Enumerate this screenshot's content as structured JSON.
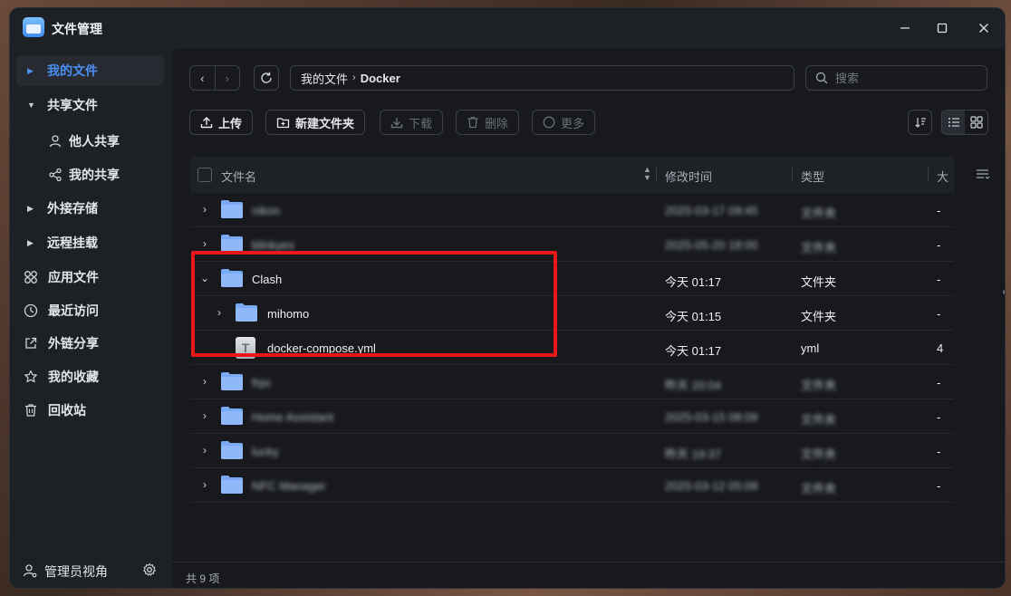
{
  "window": {
    "title": "文件管理"
  },
  "sidebar": {
    "items": [
      {
        "label": "我的文件"
      },
      {
        "label": "共享文件"
      },
      {
        "label": "他人共享"
      },
      {
        "label": "我的共享"
      },
      {
        "label": "外接存储"
      },
      {
        "label": "远程挂载"
      },
      {
        "label": "应用文件"
      },
      {
        "label": "最近访问"
      },
      {
        "label": "外链分享"
      },
      {
        "label": "我的收藏"
      },
      {
        "label": "回收站"
      }
    ],
    "footer_label": "管理员视角"
  },
  "breadcrumb": {
    "root": "我的文件",
    "current": "Docker"
  },
  "search": {
    "placeholder": "搜索"
  },
  "toolbar": {
    "upload": "上传",
    "new_folder": "新建文件夹",
    "download": "下载",
    "delete": "删除",
    "more": "更多"
  },
  "table": {
    "columns": {
      "name": "文件名",
      "mtime": "修改时间",
      "type": "类型",
      "size": "大"
    },
    "rows": [
      {
        "name": "nikon",
        "mtime": "2025-03-17 09:45",
        "type": "文件夹",
        "size": "-"
      },
      {
        "name": "blinkyes",
        "mtime": "2025-05-20 18:00",
        "type": "文件夹",
        "size": "-"
      },
      {
        "name": "Clash",
        "mtime": "今天 01:17",
        "type": "文件夹",
        "size": "-"
      },
      {
        "name": "mihomo",
        "mtime": "今天 01:15",
        "type": "文件夹",
        "size": "-"
      },
      {
        "name": "docker-compose.yml",
        "mtime": "今天 01:17",
        "type": "yml",
        "size": "4"
      },
      {
        "name": "frpc",
        "mtime": "昨天 20:04",
        "type": "文件夹",
        "size": "-"
      },
      {
        "name": "Home Assistant",
        "mtime": "2025-03-15 08:09",
        "type": "文件夹",
        "size": "-"
      },
      {
        "name": "lucky",
        "mtime": "昨天 19:37",
        "type": "文件夹",
        "size": "-"
      },
      {
        "name": "NFC Manager",
        "mtime": "2025-03-12 05:09",
        "type": "文件夹",
        "size": "-"
      }
    ]
  },
  "status": {
    "count": "共 9 项"
  },
  "colors": {
    "accent": "#4a8ff3",
    "highlight": "#e8171a",
    "folder": "#7aa9f5"
  }
}
